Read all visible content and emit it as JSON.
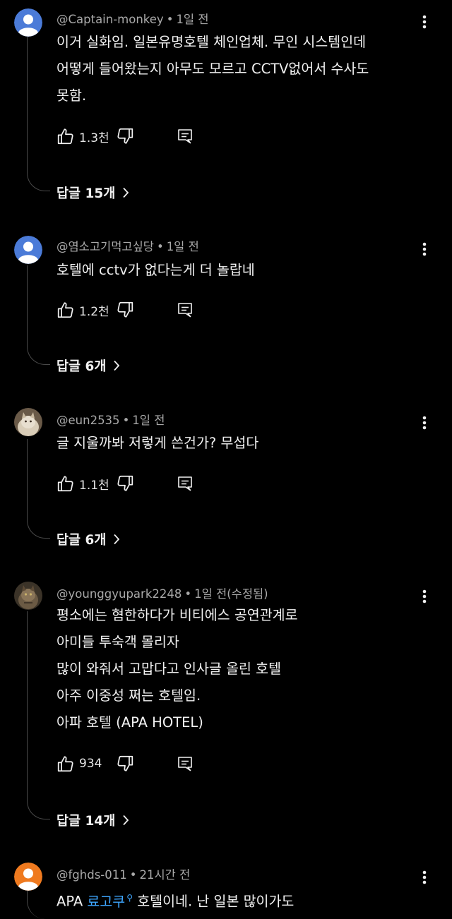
{
  "comments": [
    {
      "author": "@Captain-monkey",
      "time": "1일 전",
      "avatar": "default-avatar-blue",
      "lines": [
        "이거 실화임. 일본유명호텔 체인업체. 무인 시스템인데",
        "어떻게 들어왔는지 아무도 모르고 CCTV없어서 수사도",
        "못함."
      ],
      "likes": "1.3천",
      "replies": "답글 15개"
    },
    {
      "author": "@염소고기먹고싶당",
      "time": "1일 전",
      "avatar": "default-avatar-blue",
      "lines": [
        "호텔에 cctv가 없다는게 더 놀랍네"
      ],
      "likes": "1.2천",
      "replies": "답글 6개"
    },
    {
      "author": "@eun2535",
      "time": "1일 전",
      "avatar": "photo-avatar-cat-light",
      "lines": [
        "글 지울까봐 저렇게 쓴건가? 무섭다"
      ],
      "likes": "1.1천",
      "replies": "답글 6개"
    },
    {
      "author": "@younggyupark2248",
      "time": "1일 전(수정됨)",
      "avatar": "photo-avatar-cat-dark",
      "lines": [
        "평소에는 혐한하다가 비티에스 공연관계로",
        "아미들 투숙객 몰리자",
        "많이 와줘서 고맙다고 인사글 올린 호텔",
        "아주 이중성 쩌는 호텔임.",
        "아파 호텔 (APA HOTEL)"
      ],
      "likes": "934",
      "replies": "답글 14개"
    },
    {
      "author": "@fghds-011",
      "time": "21시간 전",
      "avatar": "default-avatar-orange",
      "line_prefix": "APA ",
      "line_link": "료고쿠",
      "line_suffix": " 호텔이네. 난 일본 많이가도"
    }
  ],
  "icons": {
    "like": "thumb-up-icon",
    "dislike": "thumb-down-icon",
    "reply": "reply-icon",
    "more": "more-vertical-icon",
    "chevron": "chevron-right-icon",
    "search": "search-icon"
  },
  "colors": {
    "background": "#000000",
    "text": "#f1f1f1",
    "meta": "#a9a9a9",
    "link": "#3ea6ff",
    "avatar_blue": "#4b7bd8",
    "avatar_orange": "#ef7a1f"
  }
}
